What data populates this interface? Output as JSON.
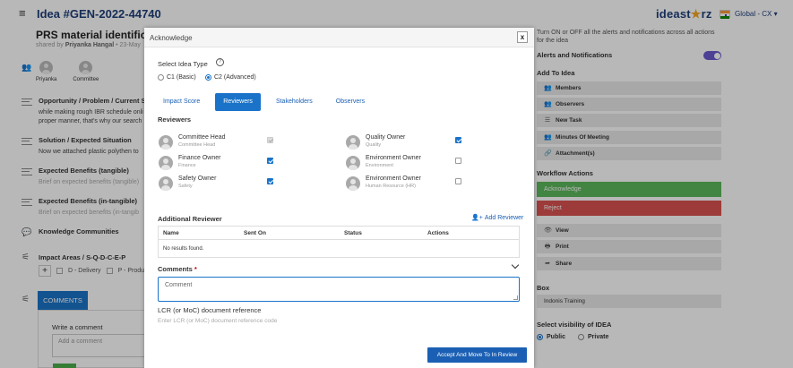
{
  "header": {
    "idea_title": "Idea #GEN-2022-44740",
    "brand_prefix": "ideast",
    "brand_star": "★",
    "brand_suffix": "rz",
    "region": "Global - CX ▾"
  },
  "idea": {
    "title": "PRS material identificatio",
    "shared_by_prefix": "shared by",
    "shared_by_name": "Priyanka Hangal",
    "shared_date": "• 23-May"
  },
  "people": [
    {
      "label": "Priyanka"
    },
    {
      "label": "Committee"
    }
  ],
  "sections": {
    "opportunity": {
      "title": "Opportunity / Problem / Current Si",
      "line1": "while making rough IBR schedule onli",
      "line2": "proper manner, that's why our search"
    },
    "solution": {
      "title": "Solution / Expected Situation",
      "desc": "Now we attached plastic polythen to"
    },
    "benefits_tangible": {
      "title": "Expected Benefits (tangible)",
      "desc": "Brief on expected benefits (tangible)"
    },
    "benefits_intangible": {
      "title": "Expected Benefits (in-tangible)",
      "desc": "Brief on expected benefits (in-tangib"
    },
    "communities": {
      "title": "Knowledge Communities"
    },
    "impact": {
      "title": "Impact Areas / S-Q-D-C-E-P",
      "plus": "+",
      "opt1": "D - Delivery",
      "opt2": "P - Produc"
    }
  },
  "comments": {
    "tab_label": "COMMENTS",
    "write_label": "Write a comment",
    "placeholder": "Add a comment"
  },
  "right_panel": {
    "notice": "Turn ON or OFF all the alerts and notifications across all actions for the idea",
    "alerts_label": "Alerts and Notifications",
    "alerts_on": true,
    "add_to_idea": "Add To Idea",
    "add_items": [
      {
        "icon": "members-icon",
        "glyph": "👥",
        "label": "Members"
      },
      {
        "icon": "observers-icon",
        "glyph": "👥",
        "label": "Observers"
      },
      {
        "icon": "task-icon",
        "glyph": "☰",
        "label": "New Task"
      },
      {
        "icon": "meeting-icon",
        "glyph": "👥",
        "label": "Minutes Of Meeting"
      },
      {
        "icon": "attachment-icon",
        "glyph": "🔗",
        "label": "Attachment(s)"
      }
    ],
    "workflow_actions": "Workflow Actions",
    "acknowledge": "Acknowledge",
    "reject": "Reject",
    "other_actions": [
      {
        "icon": "eye-icon",
        "glyph": "👁",
        "label": "View"
      },
      {
        "icon": "print-icon",
        "glyph": "🖶",
        "label": "Print"
      },
      {
        "icon": "share-icon",
        "glyph": "➦",
        "label": "Share"
      }
    ],
    "box_label": "Box",
    "box_value": "Indonis Training",
    "visibility_label": "Select visibility of IDEA",
    "public": "Public",
    "private": "Private",
    "visibility_selected": "Public"
  },
  "modal": {
    "title": "Acknowledge",
    "close": "x",
    "select_type_label": "Select Idea Type",
    "help_glyph": "?",
    "types": [
      {
        "label": "C1 (Basic)",
        "checked": false
      },
      {
        "label": "C2 (Advanced)",
        "checked": true
      }
    ],
    "tabs": [
      {
        "label": "Impact Score",
        "active": false
      },
      {
        "label": "Reviewers",
        "active": true
      },
      {
        "label": "Stakeholders",
        "active": false
      },
      {
        "label": "Observers",
        "active": false
      }
    ],
    "reviewers_label": "Reviewers",
    "reviewers": [
      {
        "name": "Committee Head",
        "role": "Committee Head",
        "state": "disabled"
      },
      {
        "name": "Quality Owner",
        "role": "Quality",
        "state": "checked"
      },
      {
        "name": "Finance Owner",
        "role": "Finance",
        "state": "checked"
      },
      {
        "name": "Environment Owner",
        "role": "Environment",
        "state": "unchecked"
      },
      {
        "name": "Safety Owner",
        "role": "Safety",
        "state": "checked"
      },
      {
        "name": "Environment Owner",
        "role": "Human Resource (HR)",
        "state": "unchecked"
      }
    ],
    "additional_reviewer": "Additional Reviewer",
    "add_reviewer": "Add Reviewer",
    "add_reviewer_glyph": "👤+",
    "table_headers": [
      "Name",
      "Sent On",
      "Status",
      "Actions"
    ],
    "no_results": "No results found.",
    "comments_label": "Comments",
    "required_mark": "*",
    "comment_placeholder": "Comment",
    "lcr_label": "LCR (or MoC) document reference",
    "lcr_hint": "Enter LCR (or MoC) document reference code",
    "submit": "Accept And Move To In Review"
  }
}
